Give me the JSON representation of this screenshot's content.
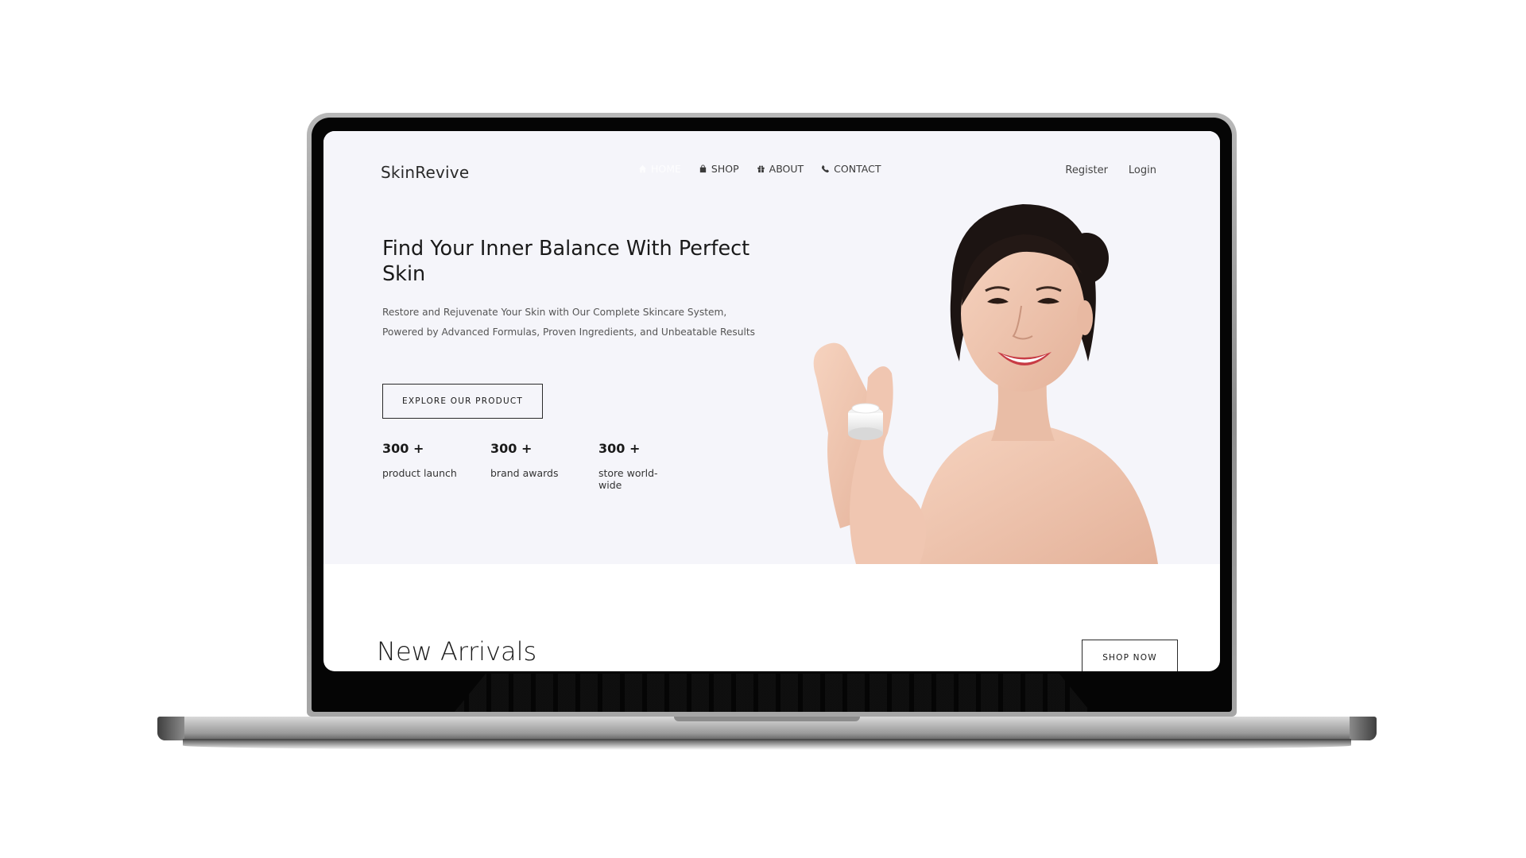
{
  "site": {
    "logo": "SkinRevive"
  },
  "nav": {
    "items": [
      {
        "label": "HOME",
        "icon": "home-icon",
        "active": true
      },
      {
        "label": "SHOP",
        "icon": "shopping-bag-icon"
      },
      {
        "label": "ABOUT",
        "icon": "gift-icon"
      },
      {
        "label": "CONTACT",
        "icon": "phone-icon"
      }
    ]
  },
  "auth": {
    "register": "Register",
    "login": "Login"
  },
  "hero": {
    "title": "Find Your Inner Balance With Perfect Skin",
    "subtitle": "Restore and Rejuvenate Your Skin with Our Complete Skincare System, Powered by Advanced Formulas, Proven Ingredients, and Unbeatable Results",
    "cta": "EXPLORE OUR PRODUCT",
    "stats": [
      {
        "value": "300 +",
        "label": "product launch"
      },
      {
        "value": "300 +",
        "label": "brand awards"
      },
      {
        "value": "300 +",
        "label": "store world-wide"
      }
    ]
  },
  "arrivals": {
    "title": "New Arrivals",
    "cta": "SHOP NOW"
  },
  "colors": {
    "hero_bg": "#f5f5fa",
    "text": "#1a1a1a",
    "laptop_frame": "#a6a6a6"
  }
}
